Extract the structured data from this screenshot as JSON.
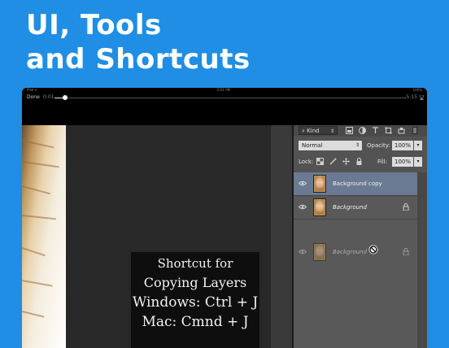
{
  "headline": {
    "line1": "UI, Tools",
    "line2": "and Shortcuts"
  },
  "status_bar": {
    "left": "iPad ✈",
    "time": "6:01 PM",
    "right": "100%"
  },
  "player": {
    "done_label": "Done",
    "elapsed": "0:01",
    "remaining": "-5:15",
    "progress": 0.03
  },
  "caption": {
    "line1": "Shortcut for",
    "line2": "Copying Layers",
    "line3": "Windows: Ctrl + J",
    "line4": "Mac: Cmnd + J"
  },
  "layers_panel": {
    "filter_kind": "Kind",
    "blend_mode": "Normal",
    "opacity_label": "Opacity:",
    "opacity_value": "100%",
    "lock_label": "Lock:",
    "fill_label": "Fill:",
    "fill_value": "100%",
    "layers": [
      {
        "name": "Background copy",
        "selected": true
      },
      {
        "name": "Background",
        "selected": false,
        "locked": true
      },
      {
        "name": "Background",
        "dragging": true,
        "locked": true
      }
    ]
  },
  "colors": {
    "background_blue": "#1f8ee4",
    "panel_gray": "#535353",
    "selected_layer": "#6a7a92"
  }
}
